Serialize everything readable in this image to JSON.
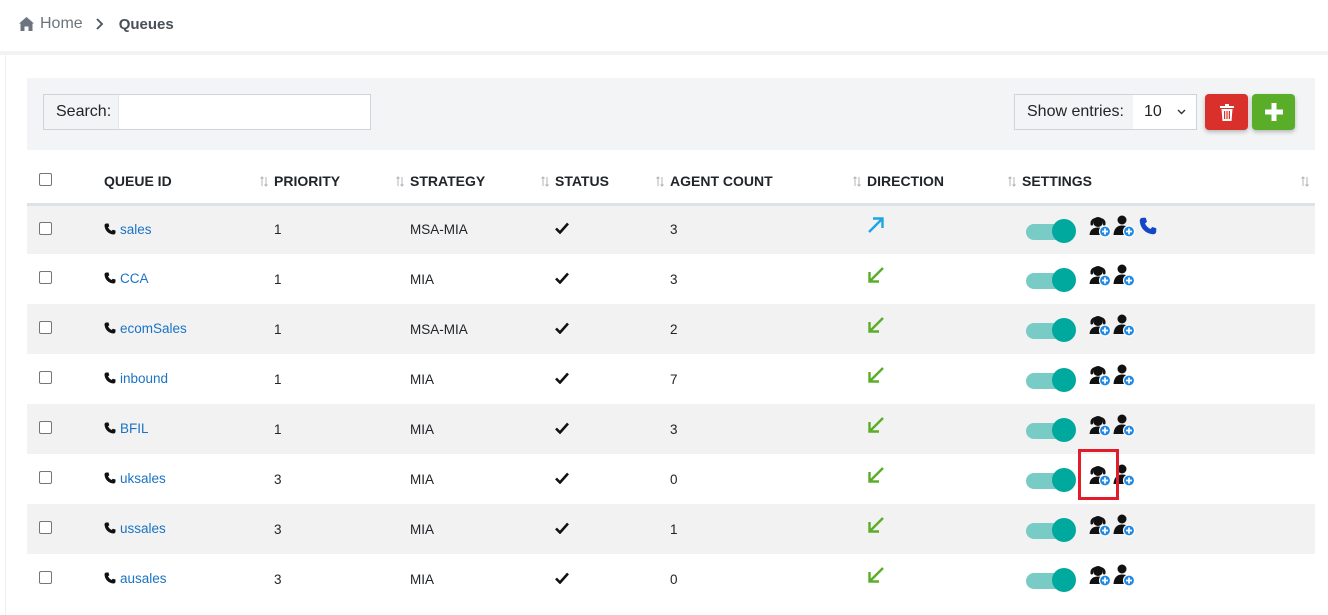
{
  "breadcrumb": {
    "home": "Home",
    "current": "Queues"
  },
  "search": {
    "label": "Search:",
    "value": ""
  },
  "entries": {
    "label": "Show entries:",
    "selected": "10"
  },
  "colors": {
    "link": "#1a73c5",
    "toggle_on": "#00a99d",
    "direction_out": "#1ea6e0",
    "direction_in": "#5aad29",
    "delete": "#d9302c",
    "add": "#5aad29",
    "highlight": "#e21c2a"
  },
  "table": {
    "columns": [
      "QUEUE ID",
      "PRIORITY",
      "STRATEGY",
      "STATUS",
      "AGENT COUNT",
      "DIRECTION",
      "SETTINGS"
    ],
    "rows": [
      {
        "queue_id": "sales",
        "priority": "1",
        "strategy": "MSA-MIA",
        "status": "check-icon",
        "agent_count": "3",
        "direction": "outbound-arrow-icon",
        "enabled": true,
        "icons": [
          "add-agent-headset-icon",
          "add-user-icon",
          "phone-icon"
        ]
      },
      {
        "queue_id": "CCA",
        "priority": "1",
        "strategy": "MIA",
        "status": "check-icon",
        "agent_count": "3",
        "direction": "inbound-arrow-icon",
        "enabled": true,
        "icons": [
          "add-agent-headset-icon",
          "add-user-icon"
        ]
      },
      {
        "queue_id": "ecomSales",
        "priority": "1",
        "strategy": "MSA-MIA",
        "status": "check-icon",
        "agent_count": "2",
        "direction": "inbound-arrow-icon",
        "enabled": true,
        "icons": [
          "add-agent-headset-icon",
          "add-user-icon"
        ]
      },
      {
        "queue_id": "inbound",
        "priority": "1",
        "strategy": "MIA",
        "status": "check-icon",
        "agent_count": "7",
        "direction": "inbound-arrow-icon",
        "enabled": true,
        "icons": [
          "add-agent-headset-icon",
          "add-user-icon"
        ]
      },
      {
        "queue_id": "BFIL",
        "priority": "1",
        "strategy": "MIA",
        "status": "check-icon",
        "agent_count": "3",
        "direction": "inbound-arrow-icon",
        "enabled": true,
        "icons": [
          "add-agent-headset-icon",
          "add-user-icon"
        ]
      },
      {
        "queue_id": "uksales",
        "priority": "3",
        "strategy": "MIA",
        "status": "check-icon",
        "agent_count": "0",
        "direction": "inbound-arrow-icon",
        "enabled": true,
        "icons": [
          "add-agent-headset-icon",
          "add-user-icon"
        ]
      },
      {
        "queue_id": "ussales",
        "priority": "3",
        "strategy": "MIA",
        "status": "check-icon",
        "agent_count": "1",
        "direction": "inbound-arrow-icon",
        "enabled": true,
        "icons": [
          "add-agent-headset-icon",
          "add-user-icon"
        ]
      },
      {
        "queue_id": "ausales",
        "priority": "3",
        "strategy": "MIA",
        "status": "check-icon",
        "agent_count": "0",
        "direction": "inbound-arrow-icon",
        "enabled": true,
        "icons": [
          "add-agent-headset-icon",
          "add-user-icon"
        ]
      }
    ]
  }
}
